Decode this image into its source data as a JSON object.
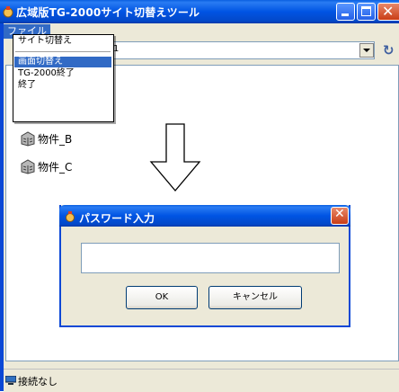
{
  "window": {
    "title": "広域版TG-2000サイト切替えツール"
  },
  "menubar": {
    "file_label": "ファイル"
  },
  "file_menu": {
    "items": [
      "サイト切替え",
      "画面切替え",
      "TG-2000終了",
      "終了"
    ],
    "selected": "画面切替え"
  },
  "site_select": {
    "value": "1"
  },
  "properties": [
    "物件_B",
    "物件_C"
  ],
  "status": {
    "text": "接続なし"
  },
  "password_dialog": {
    "title": "パスワード入力",
    "ok_label": "OK",
    "cancel_label": "キャンセル"
  },
  "colors": {
    "titlebar": "#0054e3",
    "selection": "#316ac5",
    "frame": "#ece9d8"
  }
}
